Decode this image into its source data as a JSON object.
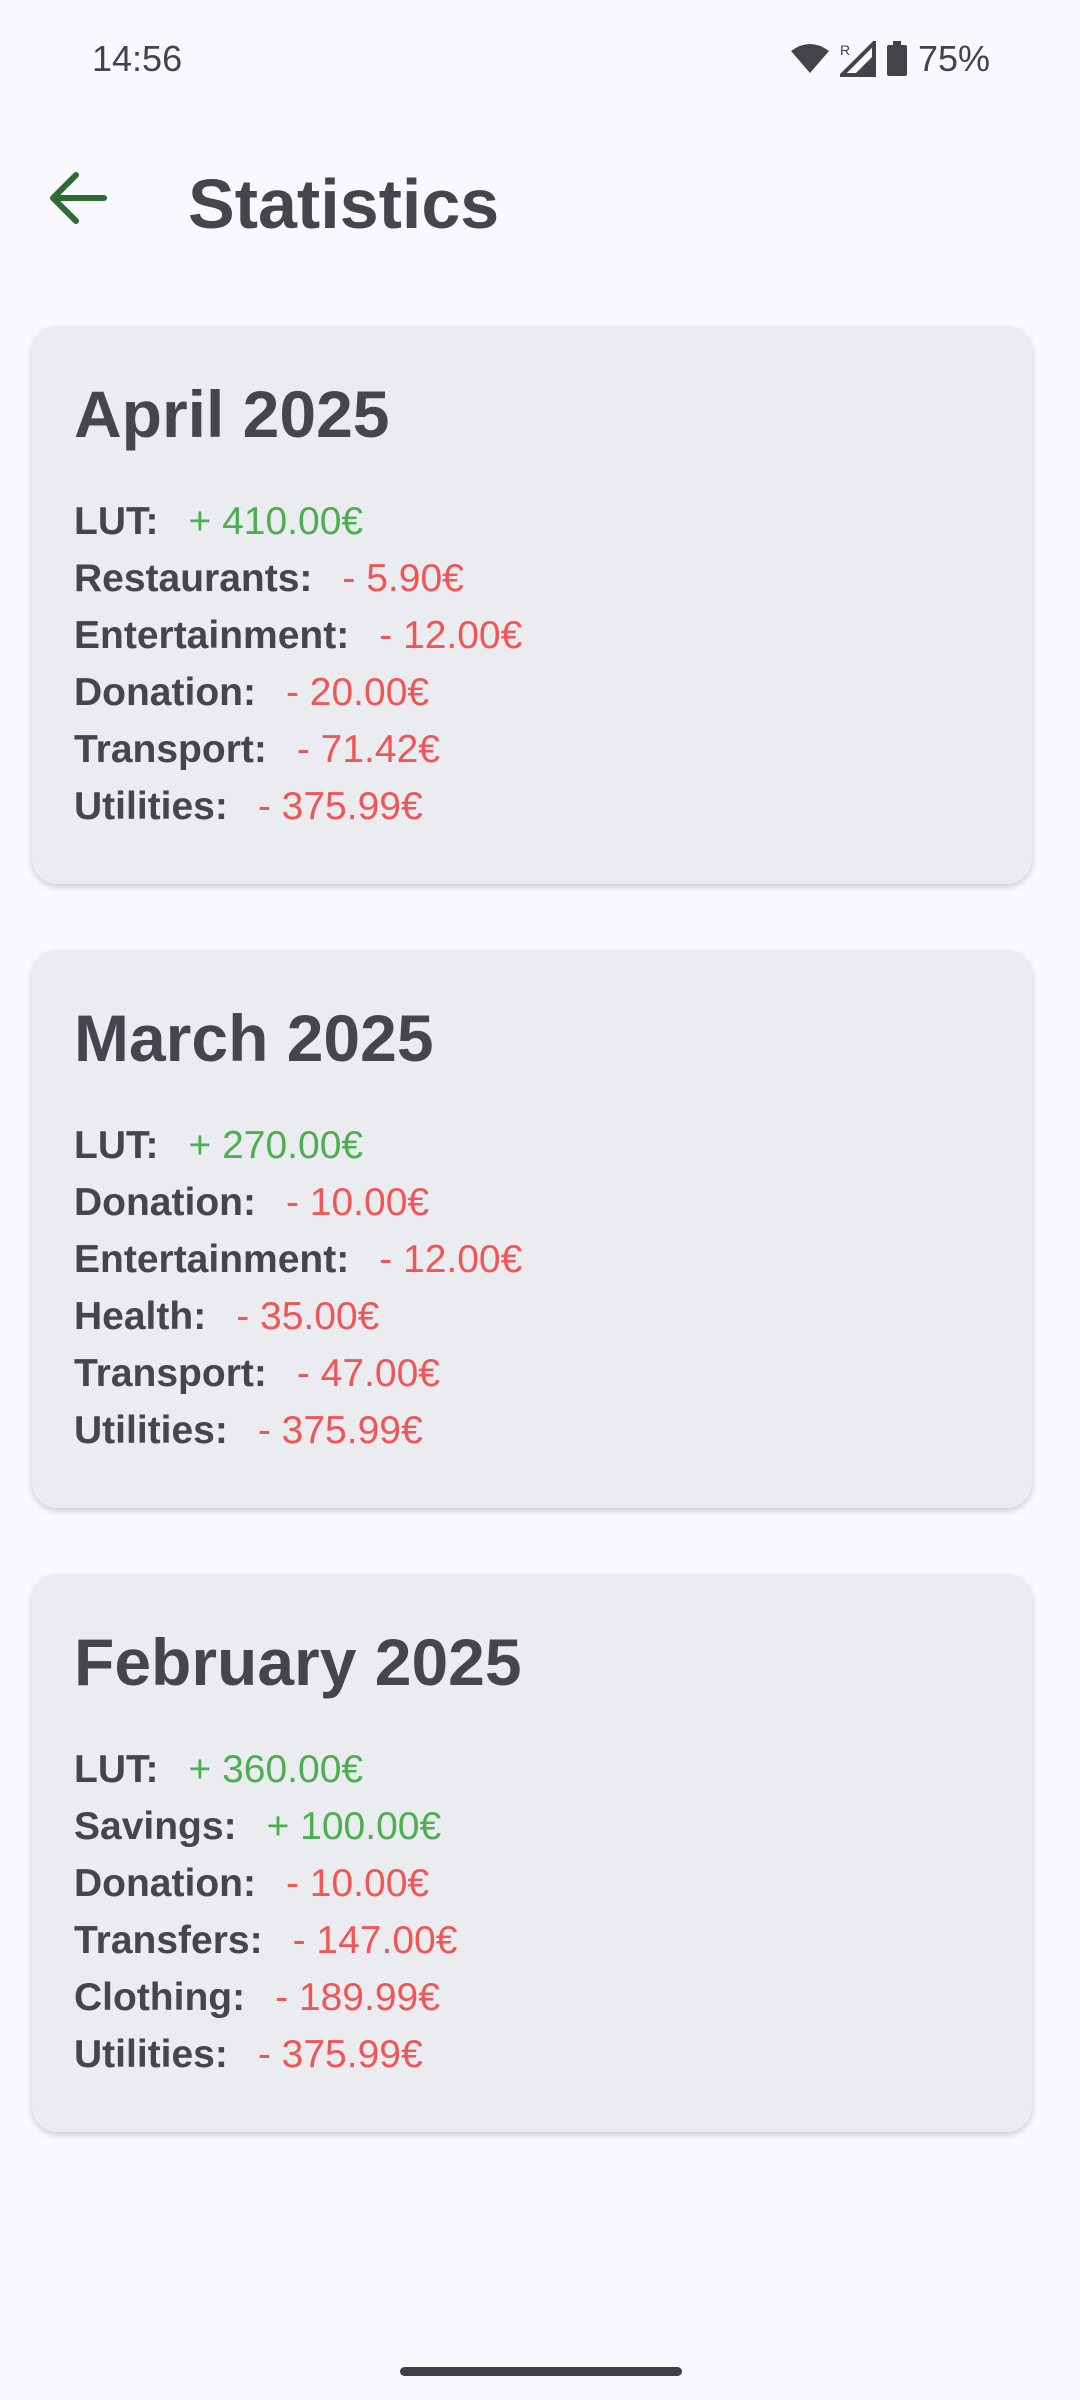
{
  "status_bar": {
    "time": "14:56",
    "battery": "75%",
    "icons": [
      "wifi-icon",
      "signal-roaming-icon",
      "battery-icon"
    ]
  },
  "app_bar": {
    "back_icon": "arrow-back-icon",
    "title": "Statistics"
  },
  "colors": {
    "background": "#f8f8fd",
    "card": "#eaecf0",
    "text": "#46454d",
    "positive": "#4caf50",
    "negative": "#f25555",
    "accent": "#2e6b35"
  },
  "months": [
    {
      "title": "April 2025",
      "entries": [
        {
          "label": "LUT:",
          "amount": "+ 410.00€",
          "sign": "positive"
        },
        {
          "label": "Restaurants:",
          "amount": "- 5.90€",
          "sign": "negative"
        },
        {
          "label": "Entertainment:",
          "amount": "- 12.00€",
          "sign": "negative"
        },
        {
          "label": "Donation:",
          "amount": "- 20.00€",
          "sign": "negative"
        },
        {
          "label": "Transport:",
          "amount": "- 71.42€",
          "sign": "negative"
        },
        {
          "label": "Utilities:",
          "amount": "- 375.99€",
          "sign": "negative"
        }
      ]
    },
    {
      "title": "March 2025",
      "entries": [
        {
          "label": "LUT:",
          "amount": "+ 270.00€",
          "sign": "positive"
        },
        {
          "label": "Donation:",
          "amount": "- 10.00€",
          "sign": "negative"
        },
        {
          "label": "Entertainment:",
          "amount": "- 12.00€",
          "sign": "negative"
        },
        {
          "label": "Health:",
          "amount": "- 35.00€",
          "sign": "negative"
        },
        {
          "label": "Transport:",
          "amount": "- 47.00€",
          "sign": "negative"
        },
        {
          "label": "Utilities:",
          "amount": "- 375.99€",
          "sign": "negative"
        }
      ]
    },
    {
      "title": "February 2025",
      "entries": [
        {
          "label": "LUT:",
          "amount": "+ 360.00€",
          "sign": "positive"
        },
        {
          "label": "Savings:",
          "amount": "+ 100.00€",
          "sign": "positive"
        },
        {
          "label": "Donation:",
          "amount": "- 10.00€",
          "sign": "negative"
        },
        {
          "label": "Transfers:",
          "amount": "- 147.00€",
          "sign": "negative"
        },
        {
          "label": "Clothing:",
          "amount": "- 189.99€",
          "sign": "negative"
        },
        {
          "label": "Utilities:",
          "amount": "- 375.99€",
          "sign": "negative"
        }
      ]
    }
  ]
}
